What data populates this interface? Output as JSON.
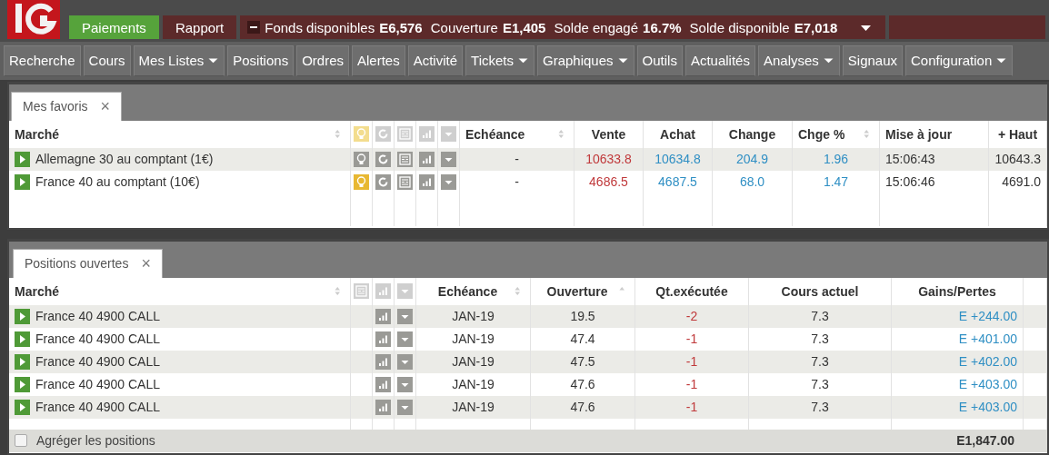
{
  "header": {
    "buttons": [
      {
        "label": "Paiements",
        "kind": "primary"
      },
      {
        "label": "Rapport",
        "kind": "secondary"
      }
    ],
    "account": [
      {
        "label": "Fonds disponibles",
        "value": "E6,576"
      },
      {
        "label": "Couverture",
        "value": "E1,405"
      },
      {
        "label": "Solde engagé",
        "value": "16.7%"
      },
      {
        "label": "Solde disponible",
        "value": "E7,018"
      }
    ]
  },
  "nav": [
    {
      "label": "Recherche",
      "dropdown": false
    },
    {
      "label": "Cours",
      "dropdown": false
    },
    {
      "label": "Mes Listes",
      "dropdown": true
    },
    {
      "label": "Positions",
      "dropdown": false
    },
    {
      "label": "Ordres",
      "dropdown": false
    },
    {
      "label": "Alertes",
      "dropdown": false
    },
    {
      "label": "Activité",
      "dropdown": false
    },
    {
      "label": "Tickets",
      "dropdown": true
    },
    {
      "label": "Graphiques",
      "dropdown": true
    },
    {
      "label": "Outils",
      "dropdown": false
    },
    {
      "label": "Actualités",
      "dropdown": false
    },
    {
      "label": "Analyses",
      "dropdown": true
    },
    {
      "label": "Signaux",
      "dropdown": false
    },
    {
      "label": "Configuration",
      "dropdown": true
    }
  ],
  "favorites": {
    "tab": "Mes favoris",
    "close": "×",
    "columns": [
      "Marché",
      "Echéance",
      "Vente",
      "Achat",
      "Change",
      "Chge %",
      "Mise à jour",
      "+ Haut"
    ],
    "rows": [
      {
        "selected": true,
        "alert": false,
        "market": "Allemagne 30 au comptant (1€)",
        "expiry": "-",
        "sell": "10633.8",
        "buy": "10634.8",
        "change": "204.9",
        "change_pct": "1.96",
        "updated": "15:06:43",
        "high": "10643.3"
      },
      {
        "selected": false,
        "alert": true,
        "market": "France 40 au comptant (10€)",
        "expiry": "-",
        "sell": "4686.5",
        "buy": "4687.5",
        "change": "68.0",
        "change_pct": "1.47",
        "updated": "15:06:46",
        "high": "4691.0"
      }
    ]
  },
  "positions": {
    "tab": "Positions ouvertes",
    "close": "×",
    "columns": [
      "Marché",
      "Echéance",
      "Ouverture",
      "Qt.exécutée",
      "Cours actuel",
      "Gains/Pertes"
    ],
    "rows": [
      {
        "market": "France 40 4900 CALL",
        "expiry": "JAN-19",
        "open": "19.5",
        "qty": "-2",
        "current": "7.3",
        "pnl": "E +244.00"
      },
      {
        "market": "France 40 4900 CALL",
        "expiry": "JAN-19",
        "open": "47.4",
        "qty": "-1",
        "current": "7.3",
        "pnl": "E +401.00"
      },
      {
        "market": "France 40 4900 CALL",
        "expiry": "JAN-19",
        "open": "47.5",
        "qty": "-1",
        "current": "7.3",
        "pnl": "E +402.00"
      },
      {
        "market": "France 40 4900 CALL",
        "expiry": "JAN-19",
        "open": "47.6",
        "qty": "-1",
        "current": "7.3",
        "pnl": "E +403.00"
      },
      {
        "market": "France 40 4900 CALL",
        "expiry": "JAN-19",
        "open": "47.6",
        "qty": "-1",
        "current": "7.3",
        "pnl": "E +403.00"
      }
    ],
    "aggregate": {
      "label": "Agréger les positions",
      "checked": false
    },
    "total": "E1,847.00"
  }
}
